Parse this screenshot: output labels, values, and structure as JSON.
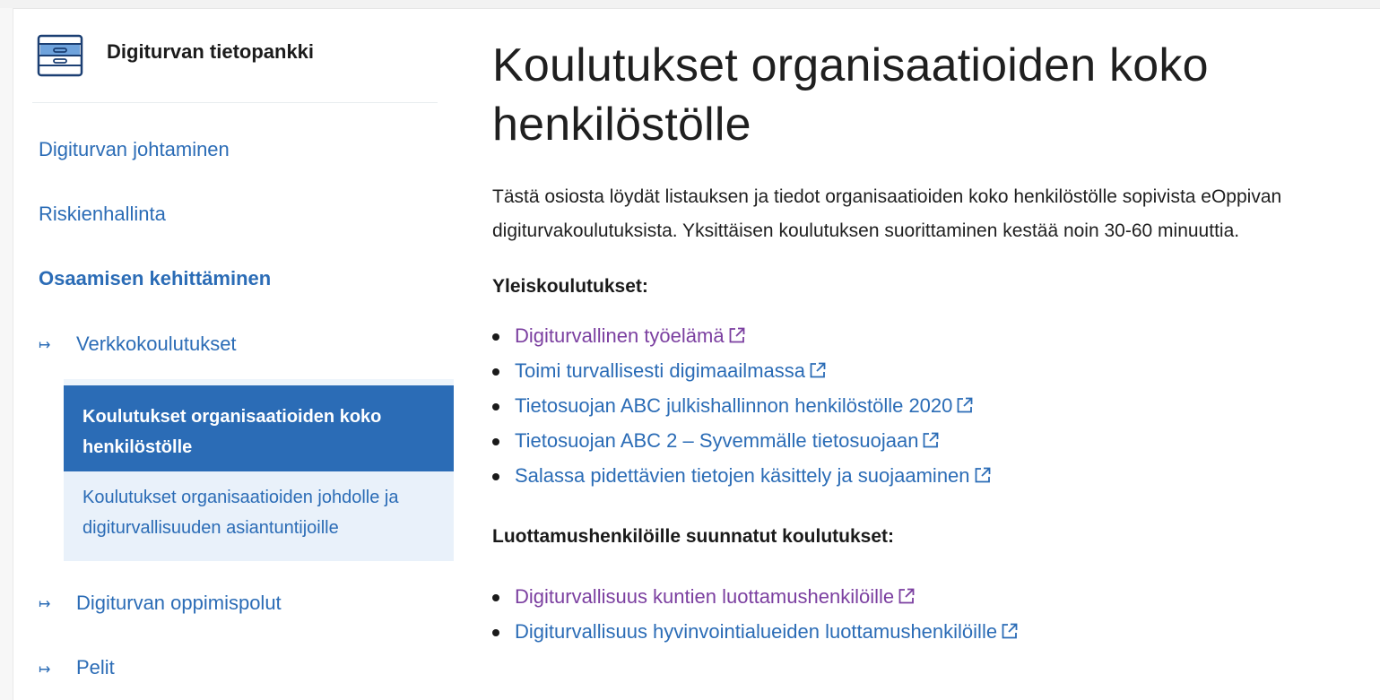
{
  "sidebar": {
    "brand_title": "Digiturvan tietopankki",
    "brand_icon": "drawer-cabinet-icon",
    "items": [
      {
        "label": "Digiturvan johtaminen"
      },
      {
        "label": "Riskienhallinta"
      },
      {
        "label": "Osaamisen kehittäminen"
      },
      {
        "label": "Verkkokoulutukset"
      },
      {
        "label": "Digiturvan oppimispolut"
      },
      {
        "label": "Pelit"
      }
    ],
    "arrow_glyph": "↦",
    "subitems": [
      {
        "label": "Koulutukset organisaatioiden koko henkilöstölle",
        "active": true
      },
      {
        "label": "Koulutukset organisaatioiden johdolle ja digiturvallisuuden asiantuntijoille",
        "active": false
      }
    ]
  },
  "main": {
    "title": "Koulutukset organisaatioiden koko henkilöstölle",
    "intro": "Tästä osiosta löydät listauksen ja tiedot organisaatioiden koko henkilöstölle sopivista eOppivan digiturvakoulutuksista. Yksittäisen koulutuksen suorittaminen kestää noin 30-60 minuuttia.",
    "sections": [
      {
        "heading": "Yleiskoulutukset:",
        "links": [
          {
            "label": "Digiturvallinen työelämä",
            "visited": true
          },
          {
            "label": "Toimi turvallisesti digimaailmassa",
            "visited": false
          },
          {
            "label": "Tietosuojan ABC julkishallinnon henkilöstölle 2020",
            "visited": false
          },
          {
            "label": "Tietosuojan ABC 2 – Syvemmälle tietosuojaan",
            "visited": false
          },
          {
            "label": "Salassa pidettävien tietojen käsittely ja suojaaminen",
            "visited": false
          }
        ]
      },
      {
        "heading": "Luottamushenkilöille suunnatut koulutukset:",
        "links": [
          {
            "label": "Digiturvallisuus kuntien luottamushenkilöille",
            "visited": true
          },
          {
            "label": "Digiturvallisuus hyvinvointialueiden luottamushenkilöille",
            "visited": false
          }
        ]
      }
    ],
    "external_icon": "external-link-icon"
  },
  "colors": {
    "link": "#2b6cb6",
    "visited": "#7b3fa0",
    "active_bg": "#2b6cb6",
    "sub_bg": "#e9f1fa",
    "text": "#1a1a1a"
  }
}
